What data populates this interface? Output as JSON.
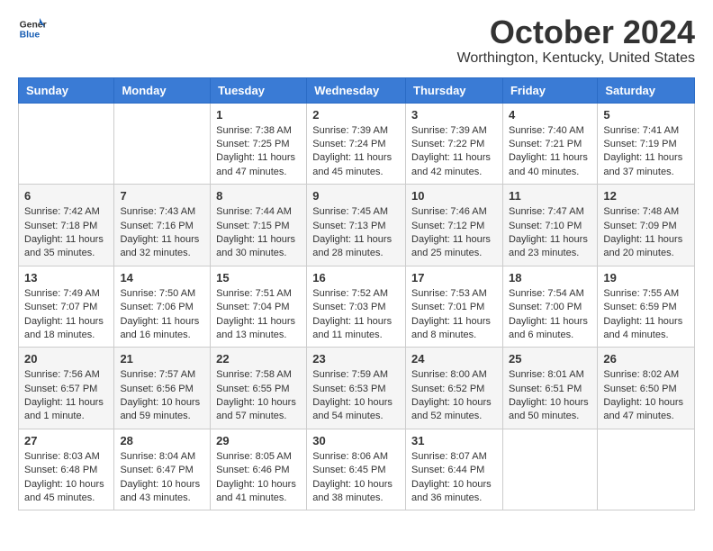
{
  "header": {
    "logo_line1": "General",
    "logo_line2": "Blue",
    "month_title": "October 2024",
    "location": "Worthington, Kentucky, United States"
  },
  "weekdays": [
    "Sunday",
    "Monday",
    "Tuesday",
    "Wednesday",
    "Thursday",
    "Friday",
    "Saturday"
  ],
  "weeks": [
    [
      {
        "day": "",
        "info": ""
      },
      {
        "day": "",
        "info": ""
      },
      {
        "day": "1",
        "info": "Sunrise: 7:38 AM\nSunset: 7:25 PM\nDaylight: 11 hours and 47 minutes."
      },
      {
        "day": "2",
        "info": "Sunrise: 7:39 AM\nSunset: 7:24 PM\nDaylight: 11 hours and 45 minutes."
      },
      {
        "day": "3",
        "info": "Sunrise: 7:39 AM\nSunset: 7:22 PM\nDaylight: 11 hours and 42 minutes."
      },
      {
        "day": "4",
        "info": "Sunrise: 7:40 AM\nSunset: 7:21 PM\nDaylight: 11 hours and 40 minutes."
      },
      {
        "day": "5",
        "info": "Sunrise: 7:41 AM\nSunset: 7:19 PM\nDaylight: 11 hours and 37 minutes."
      }
    ],
    [
      {
        "day": "6",
        "info": "Sunrise: 7:42 AM\nSunset: 7:18 PM\nDaylight: 11 hours and 35 minutes."
      },
      {
        "day": "7",
        "info": "Sunrise: 7:43 AM\nSunset: 7:16 PM\nDaylight: 11 hours and 32 minutes."
      },
      {
        "day": "8",
        "info": "Sunrise: 7:44 AM\nSunset: 7:15 PM\nDaylight: 11 hours and 30 minutes."
      },
      {
        "day": "9",
        "info": "Sunrise: 7:45 AM\nSunset: 7:13 PM\nDaylight: 11 hours and 28 minutes."
      },
      {
        "day": "10",
        "info": "Sunrise: 7:46 AM\nSunset: 7:12 PM\nDaylight: 11 hours and 25 minutes."
      },
      {
        "day": "11",
        "info": "Sunrise: 7:47 AM\nSunset: 7:10 PM\nDaylight: 11 hours and 23 minutes."
      },
      {
        "day": "12",
        "info": "Sunrise: 7:48 AM\nSunset: 7:09 PM\nDaylight: 11 hours and 20 minutes."
      }
    ],
    [
      {
        "day": "13",
        "info": "Sunrise: 7:49 AM\nSunset: 7:07 PM\nDaylight: 11 hours and 18 minutes."
      },
      {
        "day": "14",
        "info": "Sunrise: 7:50 AM\nSunset: 7:06 PM\nDaylight: 11 hours and 16 minutes."
      },
      {
        "day": "15",
        "info": "Sunrise: 7:51 AM\nSunset: 7:04 PM\nDaylight: 11 hours and 13 minutes."
      },
      {
        "day": "16",
        "info": "Sunrise: 7:52 AM\nSunset: 7:03 PM\nDaylight: 11 hours and 11 minutes."
      },
      {
        "day": "17",
        "info": "Sunrise: 7:53 AM\nSunset: 7:01 PM\nDaylight: 11 hours and 8 minutes."
      },
      {
        "day": "18",
        "info": "Sunrise: 7:54 AM\nSunset: 7:00 PM\nDaylight: 11 hours and 6 minutes."
      },
      {
        "day": "19",
        "info": "Sunrise: 7:55 AM\nSunset: 6:59 PM\nDaylight: 11 hours and 4 minutes."
      }
    ],
    [
      {
        "day": "20",
        "info": "Sunrise: 7:56 AM\nSunset: 6:57 PM\nDaylight: 11 hours and 1 minute."
      },
      {
        "day": "21",
        "info": "Sunrise: 7:57 AM\nSunset: 6:56 PM\nDaylight: 10 hours and 59 minutes."
      },
      {
        "day": "22",
        "info": "Sunrise: 7:58 AM\nSunset: 6:55 PM\nDaylight: 10 hours and 57 minutes."
      },
      {
        "day": "23",
        "info": "Sunrise: 7:59 AM\nSunset: 6:53 PM\nDaylight: 10 hours and 54 minutes."
      },
      {
        "day": "24",
        "info": "Sunrise: 8:00 AM\nSunset: 6:52 PM\nDaylight: 10 hours and 52 minutes."
      },
      {
        "day": "25",
        "info": "Sunrise: 8:01 AM\nSunset: 6:51 PM\nDaylight: 10 hours and 50 minutes."
      },
      {
        "day": "26",
        "info": "Sunrise: 8:02 AM\nSunset: 6:50 PM\nDaylight: 10 hours and 47 minutes."
      }
    ],
    [
      {
        "day": "27",
        "info": "Sunrise: 8:03 AM\nSunset: 6:48 PM\nDaylight: 10 hours and 45 minutes."
      },
      {
        "day": "28",
        "info": "Sunrise: 8:04 AM\nSunset: 6:47 PM\nDaylight: 10 hours and 43 minutes."
      },
      {
        "day": "29",
        "info": "Sunrise: 8:05 AM\nSunset: 6:46 PM\nDaylight: 10 hours and 41 minutes."
      },
      {
        "day": "30",
        "info": "Sunrise: 8:06 AM\nSunset: 6:45 PM\nDaylight: 10 hours and 38 minutes."
      },
      {
        "day": "31",
        "info": "Sunrise: 8:07 AM\nSunset: 6:44 PM\nDaylight: 10 hours and 36 minutes."
      },
      {
        "day": "",
        "info": ""
      },
      {
        "day": "",
        "info": ""
      }
    ]
  ]
}
